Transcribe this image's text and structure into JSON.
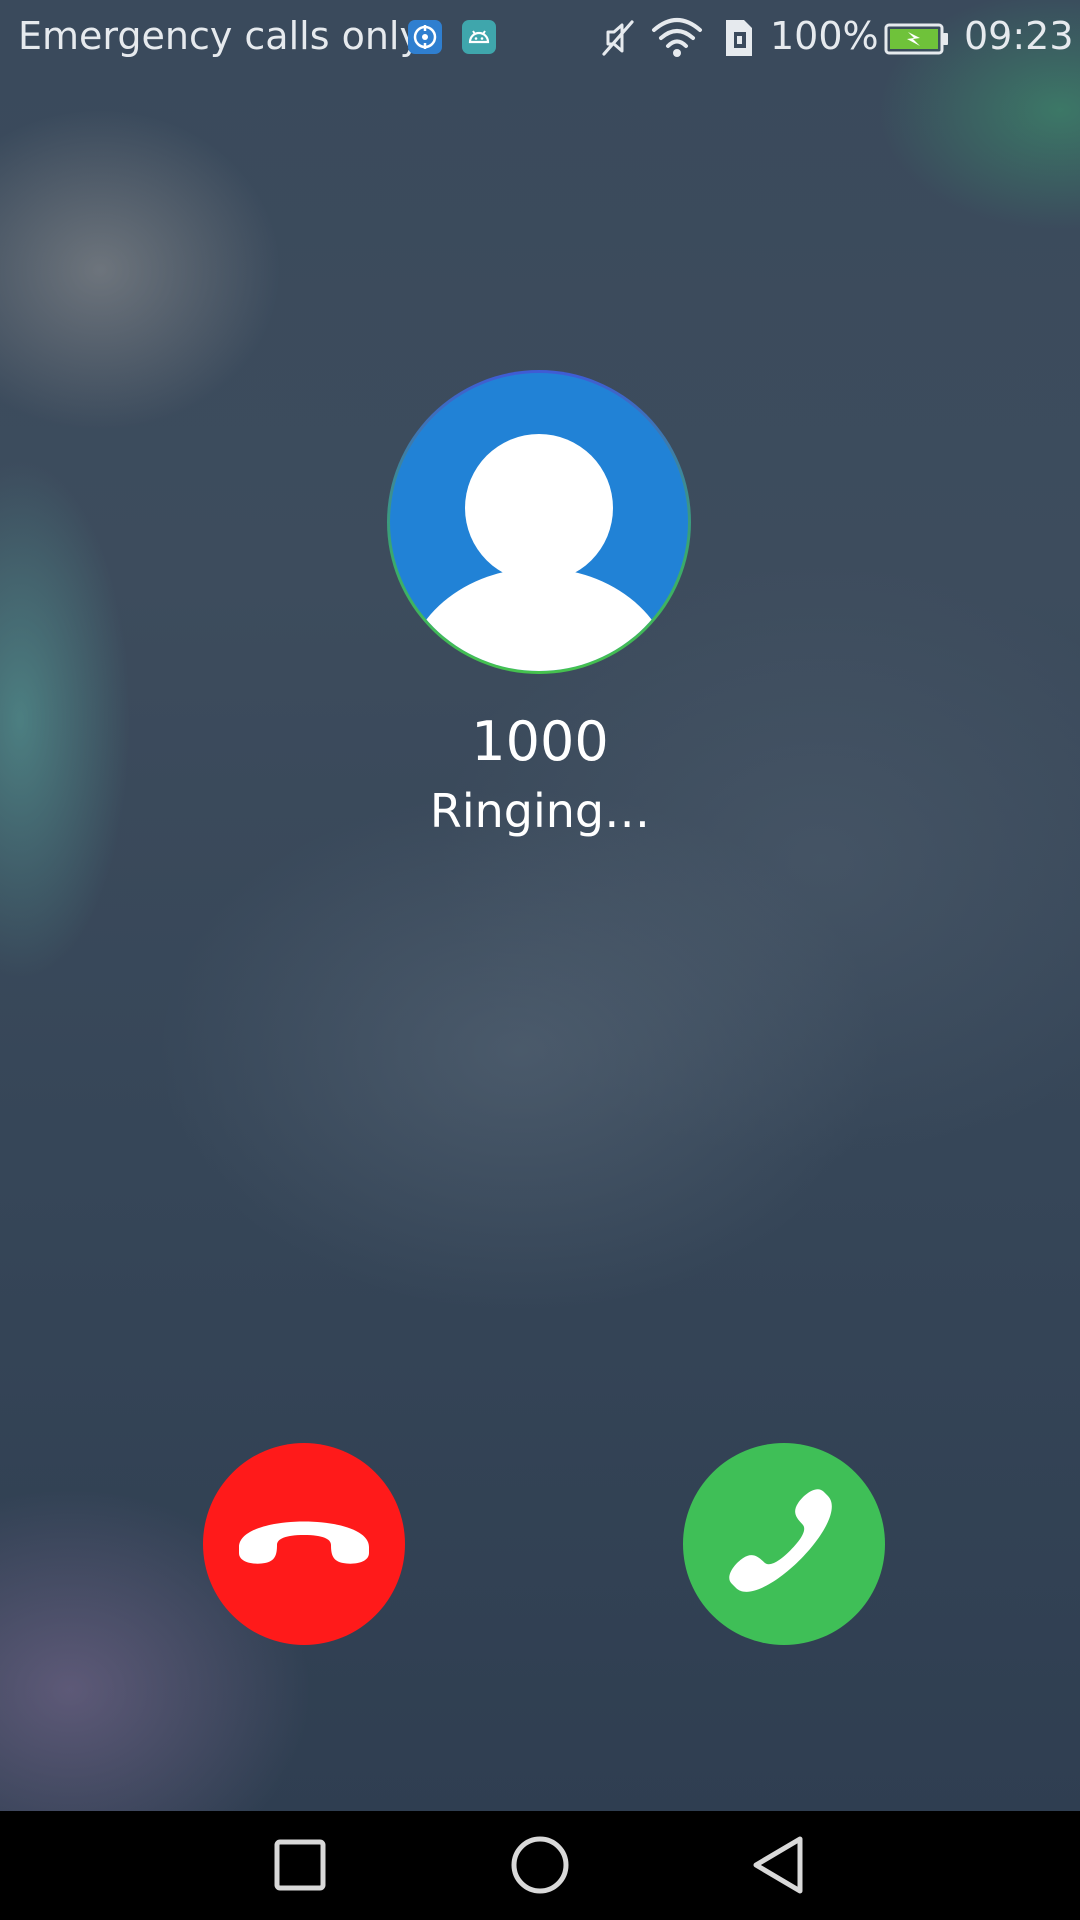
{
  "status_bar": {
    "carrier_text": "Emergency calls only",
    "notification_icons": [
      "app-notification-icon",
      "android-debug-icon"
    ],
    "system_icons": [
      "mute-icon",
      "wifi-icon",
      "sim-icon",
      "battery-charging-icon"
    ],
    "battery_percent": "100%",
    "battery_level": 1.0,
    "time": "09:23"
  },
  "call": {
    "caller_number": "1000",
    "status": "Ringing…",
    "avatar_icon": "person-icon"
  },
  "actions": {
    "decline_icon": "end-call-icon",
    "answer_icon": "phone-icon"
  },
  "nav_bar": {
    "buttons": [
      "recents-icon",
      "home-icon",
      "back-icon"
    ]
  },
  "colors": {
    "decline": "#ff1a1a",
    "answer": "#3fbf57",
    "avatar_bg": "#2182d6",
    "battery_fill": "#6fc23a"
  }
}
